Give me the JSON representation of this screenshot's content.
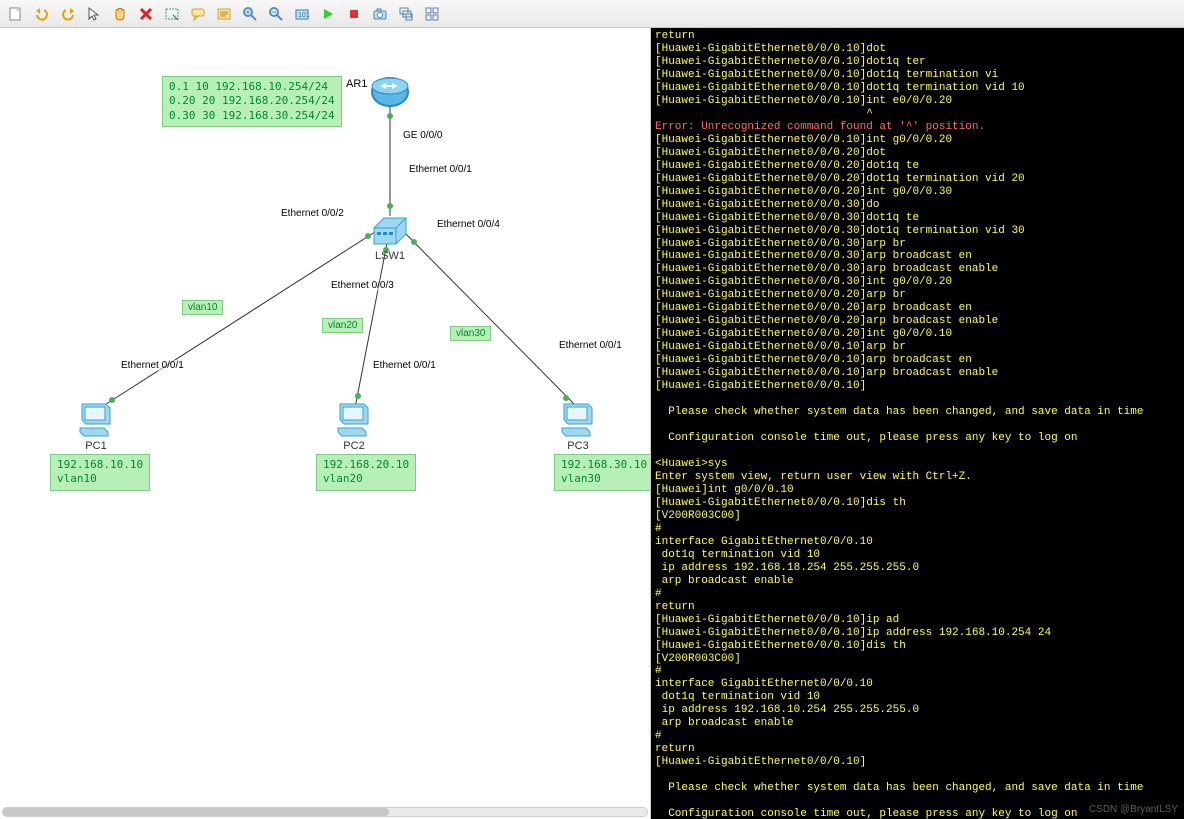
{
  "toolbar_icons": [
    "new-topology",
    "undo",
    "redo",
    "pointer",
    "hand-pan",
    "delete",
    "rectangle-select",
    "balloon",
    "note",
    "zoom-in",
    "zoom-out",
    "snapshot",
    "start-all",
    "stop-all",
    "capture",
    "stack-layout",
    "grid-layout"
  ],
  "devices": {
    "AR1": {
      "label": "AR1",
      "type": "router"
    },
    "LSW1": {
      "label": "LSW1",
      "type": "switch"
    },
    "PC1": {
      "label": "PC1",
      "type": "pc"
    },
    "PC2": {
      "label": "PC2",
      "type": "pc"
    },
    "PC3": {
      "label": "PC3",
      "type": "pc"
    }
  },
  "port_labels": {
    "ge000": "GE 0/0/0",
    "eth001_sw_top": "Ethernet 0/0/1",
    "eth002_sw": "Ethernet 0/0/2",
    "eth003_sw": "Ethernet 0/0/3",
    "eth004_sw": "Ethernet 0/0/4",
    "eth001_pc1": "Ethernet 0/0/1",
    "eth001_pc2": "Ethernet 0/0/1",
    "eth001_pc3": "Ethernet 0/0/1"
  },
  "vlan_tags": {
    "v10": "vlan10",
    "v20": "vlan20",
    "v30": "vlan30"
  },
  "notes": {
    "subif": "0.1 10 192.168.10.254/24\n0.20 20 192.168.20.254/24\n0.30 30 192.168.30.254/24",
    "pc1": "192.168.10.10\nvlan10",
    "pc2": "192.168.20.10\nvlan20",
    "pc3": "192.168.30.10\nvlan30"
  },
  "terminal_lines": [
    "return",
    "[Huawei-GigabitEthernet0/0/0.10]dot",
    "[Huawei-GigabitEthernet0/0/0.10]dot1q ter",
    "[Huawei-GigabitEthernet0/0/0.10]dot1q termination vi",
    "[Huawei-GigabitEthernet0/0/0.10]dot1q termination vid 10",
    "[Huawei-GigabitEthernet0/0/0.10]int e0/0/0.20",
    "                                ^",
    "Error: Unrecognized command found at '^' position.",
    "[Huawei-GigabitEthernet0/0/0.10]int g0/0/0.20",
    "[Huawei-GigabitEthernet0/0/0.20]dot",
    "[Huawei-GigabitEthernet0/0/0.20]dot1q te",
    "[Huawei-GigabitEthernet0/0/0.20]dot1q termination vid 20",
    "[Huawei-GigabitEthernet0/0/0.20]int g0/0/0.30",
    "[Huawei-GigabitEthernet0/0/0.30]do",
    "[Huawei-GigabitEthernet0/0/0.30]dot1q te",
    "[Huawei-GigabitEthernet0/0/0.30]dot1q termination vid 30",
    "[Huawei-GigabitEthernet0/0/0.30]arp br",
    "[Huawei-GigabitEthernet0/0/0.30]arp broadcast en",
    "[Huawei-GigabitEthernet0/0/0.30]arp broadcast enable",
    "[Huawei-GigabitEthernet0/0/0.30]int g0/0/0.20",
    "[Huawei-GigabitEthernet0/0/0.20]arp br",
    "[Huawei-GigabitEthernet0/0/0.20]arp broadcast en",
    "[Huawei-GigabitEthernet0/0/0.20]arp broadcast enable",
    "[Huawei-GigabitEthernet0/0/0.20]int g0/0/0.10",
    "[Huawei-GigabitEthernet0/0/0.10]arp br",
    "[Huawei-GigabitEthernet0/0/0.10]arp broadcast en",
    "[Huawei-GigabitEthernet0/0/0.10]arp broadcast enable",
    "[Huawei-GigabitEthernet0/0/0.10]",
    "",
    "  Please check whether system data has been changed, and save data in time",
    "",
    "  Configuration console time out, please press any key to log on",
    "",
    "<Huawei>sys",
    "Enter system view, return user view with Ctrl+Z.",
    "[Huawei]int g0/0/0.10",
    "[Huawei-GigabitEthernet0/0/0.10]dis th",
    "[V200R003C00]",
    "#",
    "interface GigabitEthernet0/0/0.10",
    " dot1q termination vid 10",
    " ip address 192.168.18.254 255.255.255.0",
    " arp broadcast enable",
    "#",
    "return",
    "[Huawei-GigabitEthernet0/0/0.10]ip ad",
    "[Huawei-GigabitEthernet0/0/0.10]ip address 192.168.10.254 24",
    "[Huawei-GigabitEthernet0/0/0.10]dis th",
    "[V200R003C00]",
    "#",
    "interface GigabitEthernet0/0/0.10",
    " dot1q termination vid 10",
    " ip address 192.168.10.254 255.255.255.0",
    " arp broadcast enable",
    "#",
    "return",
    "[Huawei-GigabitEthernet0/0/0.10]",
    "",
    "  Please check whether system data has been changed, and save data in time",
    "",
    "  Configuration console time out, please press any key to log on"
  ],
  "watermark": "CSDN @BryantLSY"
}
